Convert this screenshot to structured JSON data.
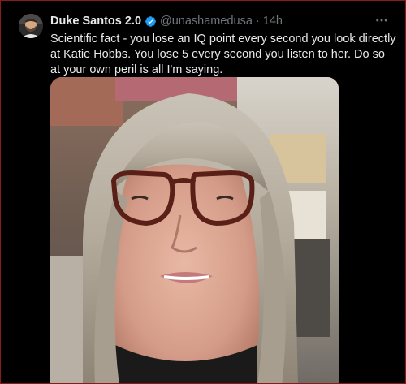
{
  "post": {
    "author_name": "Duke Santos 2.0",
    "author_handle": "@unashamedusa",
    "separator": "·",
    "time": "14h",
    "text": "Scientific fact - you lose an IQ point every second you look directly at Katie Hobbs. You lose 5 every second you listen to her. Do so at your own peril is all I'm saying.",
    "verified_color": "#1d9bf0"
  },
  "icons": {
    "verified": "verified-badge-icon",
    "more": "more-options-icon"
  }
}
